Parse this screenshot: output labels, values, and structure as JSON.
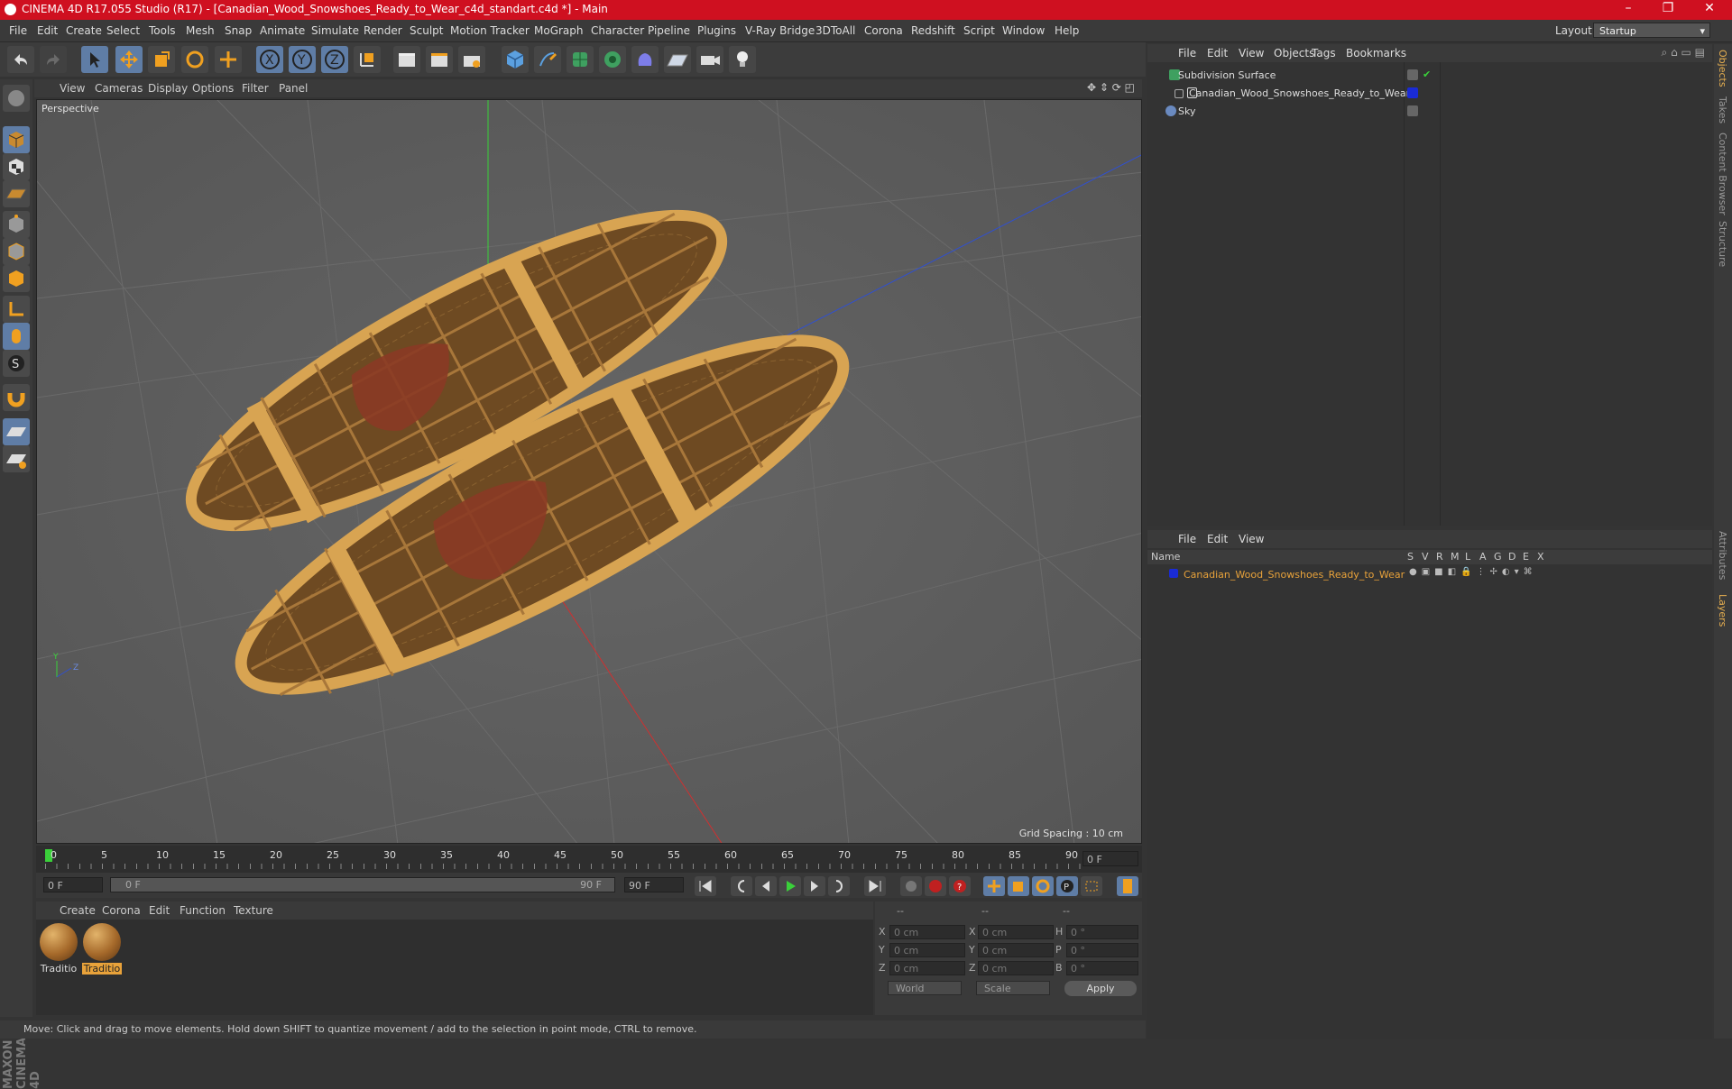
{
  "window": {
    "title": "CINEMA 4D R17.055 Studio (R17) - [Canadian_Wood_Snowshoes_Ready_to_Wear_c4d_standart.c4d *] - Main",
    "controls": [
      "–",
      "❐",
      "✕"
    ]
  },
  "menubar": {
    "items": [
      "File",
      "Edit",
      "Create",
      "Select",
      "Tools",
      "Mesh",
      "Snap",
      "Animate",
      "Simulate",
      "Render",
      "Sculpt",
      "Motion Tracker",
      "MoGraph",
      "Character",
      "Pipeline",
      "Plugins",
      "V-Ray Bridge",
      "3DToAll",
      "Corona",
      "Redshift",
      "Script",
      "Window",
      "Help"
    ],
    "layout_label": "Layout:",
    "layout_value": "Startup"
  },
  "viewport": {
    "menu": [
      "View",
      "Cameras",
      "Display",
      "Options",
      "Filter",
      "Panel"
    ],
    "label": "Perspective",
    "grid_spacing": "Grid Spacing : 10 cm"
  },
  "timeline": {
    "ticks": [
      "0",
      "5",
      "10",
      "15",
      "20",
      "25",
      "30",
      "35",
      "40",
      "45",
      "50",
      "55",
      "60",
      "65",
      "70",
      "75",
      "80",
      "85",
      "90"
    ],
    "current_frame": "0 F",
    "start_field": "0 F",
    "range_start": "0 F",
    "range_end": "90 F",
    "end_field": "90 F"
  },
  "material_manager": {
    "menu": [
      "Create",
      "Corona",
      "Edit",
      "Function",
      "Texture"
    ],
    "materials": [
      {
        "label": "Traditio",
        "selected": false
      },
      {
        "label": "Traditio",
        "selected": true
      }
    ]
  },
  "coordinates": {
    "header": [
      "--",
      "--",
      "--"
    ],
    "rows": [
      {
        "a": "X",
        "a_val": "0 cm",
        "b": "X",
        "b_val": "0 cm",
        "c": "H",
        "c_val": "0 °"
      },
      {
        "a": "Y",
        "a_val": "0 cm",
        "b": "Y",
        "b_val": "0 cm",
        "c": "P",
        "c_val": "0 °"
      },
      {
        "a": "Z",
        "a_val": "0 cm",
        "b": "Z",
        "b_val": "0 cm",
        "c": "B",
        "c_val": "0 °"
      }
    ],
    "space": "World",
    "mode": "Scale",
    "apply": "Apply"
  },
  "object_manager": {
    "menu": [
      "File",
      "Edit",
      "View",
      "Objects",
      "Tags",
      "Bookmarks"
    ],
    "objects": [
      {
        "name": "Subdivision Surface",
        "icon": "subdivision-icon"
      },
      {
        "name": "Canadian_Wood_Snowshoes_Ready_to_Wear",
        "icon": "null-object-icon"
      },
      {
        "name": "Sky",
        "icon": "sky-icon"
      }
    ]
  },
  "layer_manager": {
    "menu": [
      "File",
      "Edit",
      "View"
    ],
    "columns": [
      "Name",
      "S",
      "V",
      "R",
      "M",
      "L",
      "A",
      "G",
      "D",
      "E",
      "X"
    ],
    "layers": [
      {
        "name": "Canadian_Wood_Snowshoes_Ready_to_Wear",
        "color": "#1a2bd6"
      }
    ]
  },
  "right_tabs": [
    "Objects",
    "Takes",
    "Content Browser",
    "Structure",
    "Attributes",
    "Layers"
  ],
  "status": "Move: Click and drag to move elements. Hold down SHIFT to quantize movement / add to the selection in point mode, CTRL to remove.",
  "brand": "MAXON CINEMA 4D",
  "colors": {
    "accent": "#5f7da6",
    "titlebar": "#cf1020",
    "selected_text": "#e8a23a"
  }
}
